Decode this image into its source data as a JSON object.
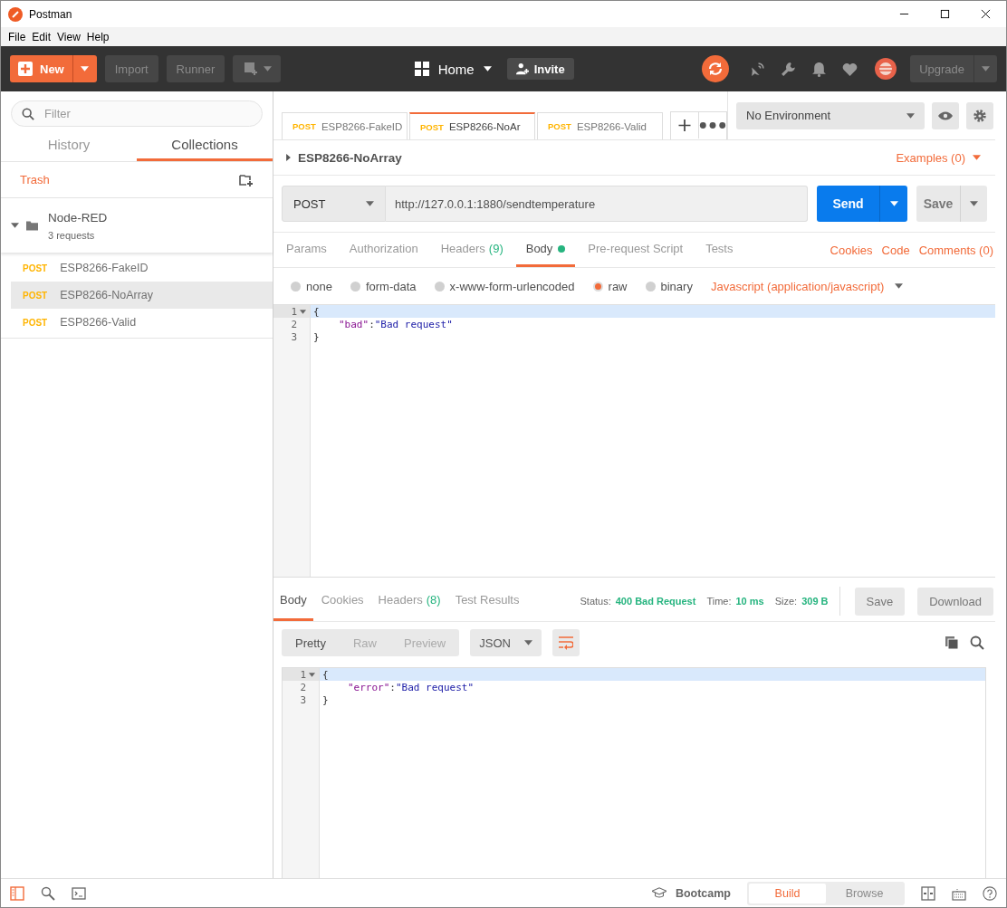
{
  "window": {
    "title": "Postman"
  },
  "menu": [
    "File",
    "Edit",
    "View",
    "Help"
  ],
  "toolbar": {
    "new": "New",
    "import": "Import",
    "runner": "Runner",
    "workspace": "Home",
    "invite": "Invite",
    "upgrade": "Upgrade"
  },
  "sidebar": {
    "filter_placeholder": "Filter",
    "tabs": [
      {
        "label": "History",
        "selected": false
      },
      {
        "label": "Collections",
        "selected": true
      }
    ],
    "trash": "Trash",
    "collection": {
      "name": "Node-RED",
      "count": "3 requests",
      "expanded": true,
      "requests": [
        {
          "method": "POST",
          "name": "ESP8266-FakeID",
          "selected": false
        },
        {
          "method": "POST",
          "name": "ESP8266-NoArray",
          "selected": true
        },
        {
          "method": "POST",
          "name": "ESP8266-Valid",
          "selected": false
        }
      ]
    }
  },
  "request_tabs": [
    {
      "method": "POST",
      "name": "ESP8266-FakeID",
      "selected": false
    },
    {
      "method": "POST",
      "name": "ESP8266-NoAr",
      "selected": true
    },
    {
      "method": "POST",
      "name": "ESP8266-Valid",
      "selected": false
    }
  ],
  "environment": "No Environment",
  "request": {
    "title": "ESP8266-NoArray",
    "examples": "Examples (0)",
    "method": "POST",
    "url": "http://127.0.0.1:1880/sendtemperature",
    "send": "Send",
    "save": "Save"
  },
  "request_subtabs": [
    {
      "label": "Params",
      "indicator": false,
      "selected": false
    },
    {
      "label": "Authorization",
      "indicator": false,
      "selected": false
    },
    {
      "label": "Headers",
      "count": "(9)",
      "indicator": false,
      "selected": false
    },
    {
      "label": "Body",
      "indicator": true,
      "selected": true
    },
    {
      "label": "Pre-request Script",
      "indicator": false,
      "selected": false
    },
    {
      "label": "Tests",
      "indicator": false,
      "selected": false
    }
  ],
  "request_links": [
    "Cookies",
    "Code",
    "Comments (0)"
  ],
  "body_types": [
    {
      "label": "none",
      "selected": false
    },
    {
      "label": "form-data",
      "selected": false
    },
    {
      "label": "x-www-form-urlencoded",
      "selected": false
    },
    {
      "label": "raw",
      "selected": true
    },
    {
      "label": "binary",
      "selected": false
    }
  ],
  "content_type": "Javascript (application/javascript)",
  "request_body": [
    {
      "number": "1",
      "active": true,
      "foldable": true,
      "tokens": [
        {
          "kind": "punct",
          "text": "{"
        }
      ]
    },
    {
      "number": "2",
      "active": false,
      "foldable": false,
      "tokens": [
        {
          "kind": "key",
          "text": "\"bad\""
        },
        {
          "kind": "punct",
          "text": ": "
        },
        {
          "kind": "string",
          "text": "\"Bad request\""
        }
      ]
    },
    {
      "number": "3",
      "active": false,
      "foldable": false,
      "tokens": [
        {
          "kind": "punct",
          "text": "}"
        }
      ]
    }
  ],
  "response": {
    "tabs": [
      {
        "label": "Body",
        "selected": true
      },
      {
        "label": "Cookies",
        "selected": false
      },
      {
        "label": "Headers",
        "count": "(8)",
        "selected": false
      },
      {
        "label": "Test Results",
        "selected": false
      }
    ],
    "meta": [
      {
        "label": "Status:",
        "value": "400 Bad Request"
      },
      {
        "label": "Time:",
        "value": "10 ms"
      },
      {
        "label": "Size:",
        "value": "309 B"
      }
    ],
    "save": "Save",
    "download": "Download",
    "view_modes": [
      {
        "label": "Pretty",
        "selected": true
      },
      {
        "label": "Raw",
        "selected": false
      },
      {
        "label": "Preview",
        "selected": false
      }
    ],
    "format": "JSON",
    "body": [
      {
        "number": "1",
        "active": true,
        "foldable": true,
        "tokens": [
          {
            "kind": "punct",
            "text": "{"
          }
        ]
      },
      {
        "number": "2",
        "active": false,
        "foldable": false,
        "tokens": [
          {
            "kind": "key",
            "text": "\"error\""
          },
          {
            "kind": "punct",
            "text": ": "
          },
          {
            "kind": "string",
            "text": "\"Bad request\""
          }
        ]
      },
      {
        "number": "3",
        "active": false,
        "foldable": false,
        "tokens": [
          {
            "kind": "punct",
            "text": "}"
          }
        ]
      }
    ]
  },
  "status_bar": {
    "bootcamp": "Bootcamp",
    "modes": [
      {
        "label": "Build",
        "selected": true
      },
      {
        "label": "Browse",
        "selected": false
      }
    ]
  }
}
